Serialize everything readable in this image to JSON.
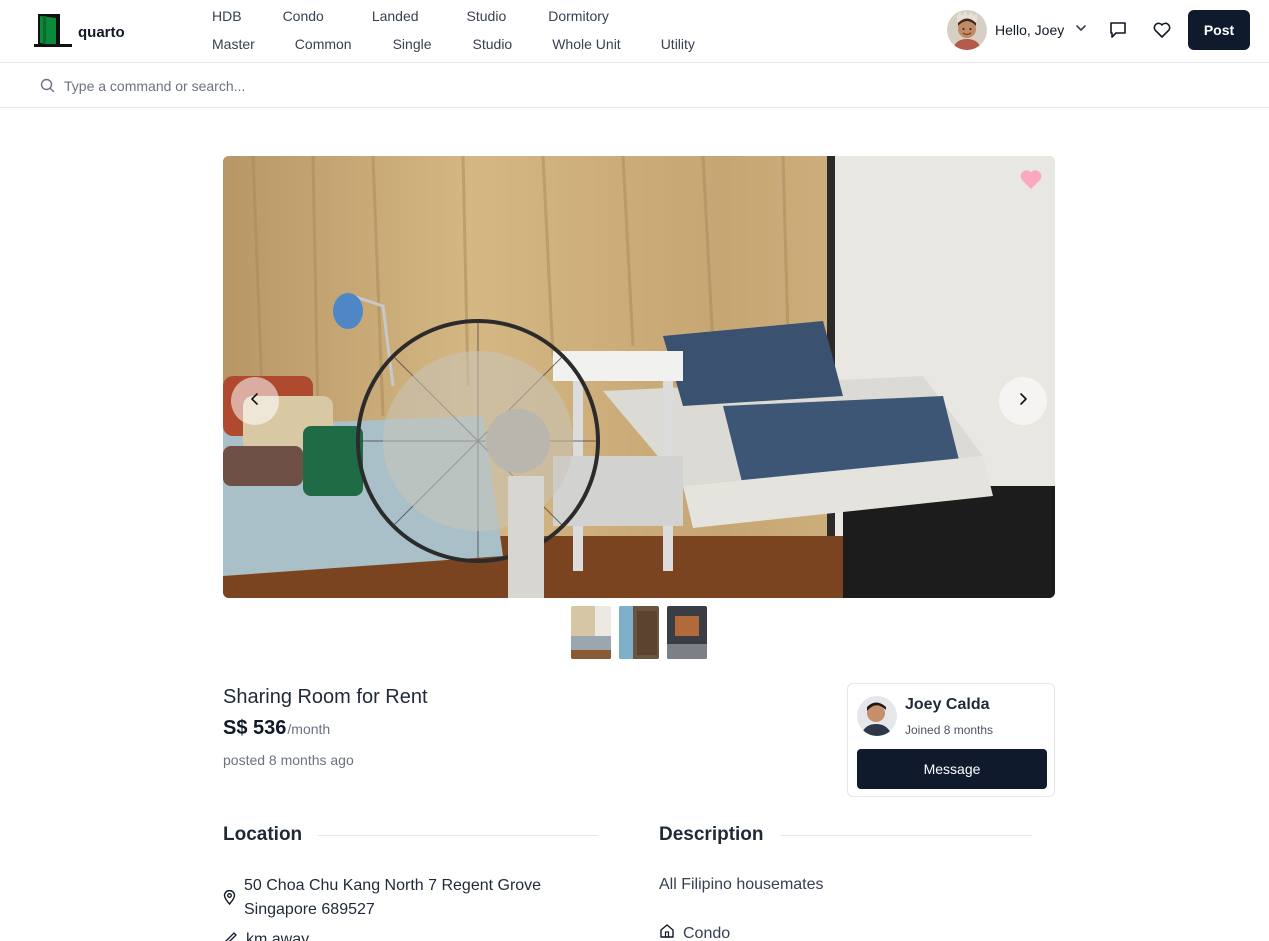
{
  "app": {
    "brand": "quarto",
    "greeting": "Hello, Joey",
    "post_label": "Post"
  },
  "nav": {
    "row1": [
      "HDB",
      "Condo",
      "Landed",
      "Studio",
      "Dormitory"
    ],
    "row2": [
      "Master",
      "Common",
      "Single",
      "Studio",
      "Whole Unit",
      "Utility"
    ]
  },
  "search": {
    "placeholder": "Type a command or search..."
  },
  "gallery": {
    "thumbnail_count": 3,
    "colors": {
      "curtain": "#c9ab78",
      "bedding": "#3a5270",
      "floor": "#7a4420",
      "favorite": "#f9a8c0"
    }
  },
  "listing": {
    "title": "Sharing Room for Rent",
    "price": "S$ 536",
    "price_unit": "/month",
    "posted": "posted 8 months ago"
  },
  "owner": {
    "name": "Joey Calda",
    "joined": "Joined 8 months",
    "message_label": "Message"
  },
  "location": {
    "heading": "Location",
    "address_line1": "50 Choa Chu Kang North 7 Regent Grove",
    "address_line2": "Singapore 689527",
    "distance": "km away"
  },
  "description": {
    "heading": "Description",
    "text": "All Filipino housemates",
    "property_type": "Condo"
  },
  "theme": {
    "primary": "#0f1b2d",
    "logo_green": "#0a8a3a",
    "muted": "#6b7280"
  }
}
